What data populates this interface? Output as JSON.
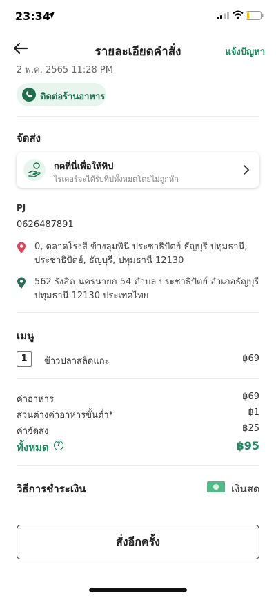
{
  "status_bar": {
    "time": "23:34"
  },
  "nav": {
    "title": "รายละเอียดคำสั่ง",
    "report_label": "แจ้งปัญหา"
  },
  "order": {
    "date": "2 พ.ค. 2565 11:28 PM",
    "contact_label": "ติดต่อร้านอาหาร"
  },
  "delivery": {
    "section_title": "จัดส่ง",
    "tip": {
      "title": "กดที่นี่เพื่อให้ทิป",
      "subtitle": "ไรเดอร์จะได้รับทิปทั้งหมดโดยไม่ถูกหัก"
    },
    "customer_name": "PJ",
    "customer_phone": "0626487891",
    "pickup_address_line1": "0, ตลาดโรงสี ข้างลุมพินี ประชาธิปัตย์ ธัญบุรี ปทุมธานี,",
    "pickup_address_line2": "ประชาธิปัตย์, ธัญบุรี, ปทุมธานี 12130",
    "dropoff_address_line1": "562 รังสิต-นครนายก 54 ตำบล ประชาธิปัตย์ อำเภอธัญบุรี",
    "dropoff_address_line2": "ปทุมธานี 12130 ประเทศไทย",
    "colors": {
      "pickup_pin": "#e0445a",
      "dropoff_pin": "#2e6e57"
    }
  },
  "menu": {
    "section_title": "เมนู",
    "items": [
      {
        "qty": "1",
        "name": "ข้าวปลาสลิดแกะ",
        "price": "฿69"
      }
    ]
  },
  "summary": {
    "food_label": "ค่าอาหาร",
    "food_value": "฿69",
    "min_diff_label": "ส่วนต่างค่าอาหารขั้นต่ำ*",
    "min_diff_value": "฿1",
    "delivery_label": "ค่าจัดส่ง",
    "delivery_value": "฿25",
    "total_label": "ทั้งหมด",
    "total_value": "฿95",
    "help_glyph": "?"
  },
  "payment": {
    "label": "วิธีการชำระเงิน",
    "method": "เงินสด"
  },
  "reorder_label": "สั่งอีกครั้ง",
  "theme": {
    "accent": "#1e8a5e",
    "accent_dark": "#1f6e4f",
    "pill_bg": "#e8f5ef"
  }
}
